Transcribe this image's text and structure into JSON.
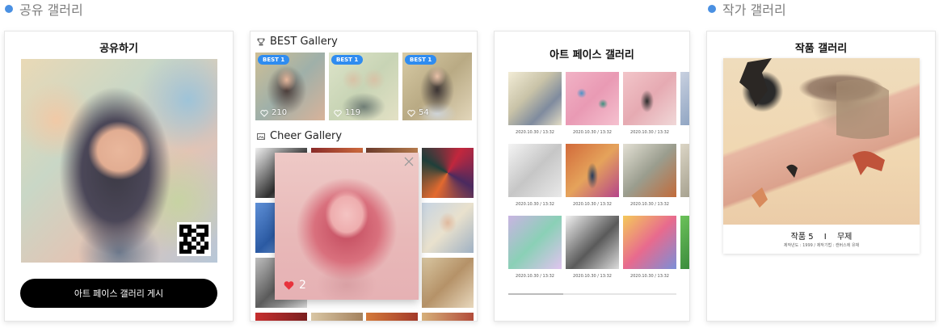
{
  "sections": {
    "shared_gallery": "공유 갤러리",
    "artist_gallery": "작가 갤러리"
  },
  "share_card": {
    "title": "공유하기",
    "button_label": "아트 페이스 갤러리 게시"
  },
  "gallery_card": {
    "best_title": "BEST Gallery",
    "best_items": [
      {
        "badge": "BEST 1",
        "likes": "210"
      },
      {
        "badge": "BEST 1",
        "likes": "119"
      },
      {
        "badge": "BEST 1",
        "likes": "54"
      }
    ],
    "cheer_title": "Cheer Gallery",
    "popup": {
      "likes": "2"
    }
  },
  "artface_card": {
    "title": "아트 페이스 갤러리",
    "items": [
      {
        "date": "2020.10.30 / 13:32"
      },
      {
        "date": "2020.10.30 / 13:32"
      },
      {
        "date": "2020.10.30 / 13:32"
      },
      {
        "date": "2020.10.30 / 13:32"
      },
      {
        "date": "2020.10.30 / 13:32"
      },
      {
        "date": "2020.10.30 / 13:32"
      },
      {
        "date": "2020.10.30 / 13:32"
      },
      {
        "date": "2020.10.30 / 13:32"
      },
      {
        "date": "2020.10.30 / 13:32"
      }
    ]
  },
  "work_card": {
    "title": "작품 갤러리",
    "work_name": "작품 5",
    "separator": "I",
    "work_subtitle": "무제",
    "work_meta": "제작년도 : 1999 / 제작기법 : 캔버스에 유채"
  },
  "colors": {
    "accent_blue": "#2f8cf0",
    "section_dot": "#4a90e2",
    "button_black": "#000000"
  }
}
